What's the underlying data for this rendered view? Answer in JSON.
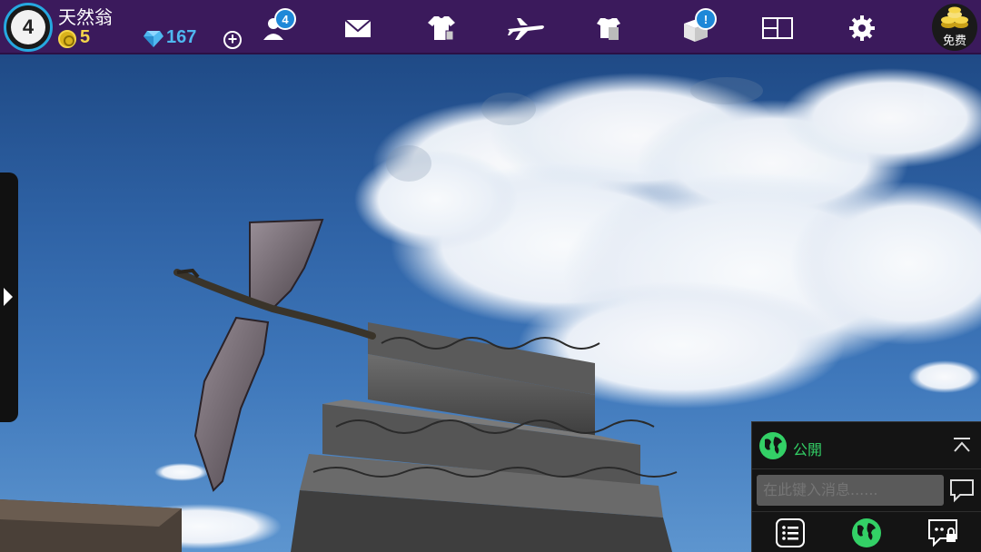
{
  "player": {
    "level": "4",
    "name": "天然翁",
    "coins": "5",
    "gems": "167"
  },
  "toolbar": {
    "friends_badge": "4",
    "shop_badge": "!",
    "icons": [
      "friends-icon",
      "mail-icon",
      "clothing-icon",
      "airplane-icon",
      "wardrobe-icon",
      "gift-box-icon",
      "layout-icon",
      "settings-icon"
    ]
  },
  "free_button": {
    "label": "免费"
  },
  "chat": {
    "channel": "公開",
    "input_placeholder": "在此键入消息......"
  },
  "colors": {
    "topbar": "#3b1a5c",
    "accent_blue": "#1e88d8",
    "coin_gold": "#f5d54a",
    "gem_blue": "#4fb8f0",
    "chat_green": "#33d066"
  }
}
